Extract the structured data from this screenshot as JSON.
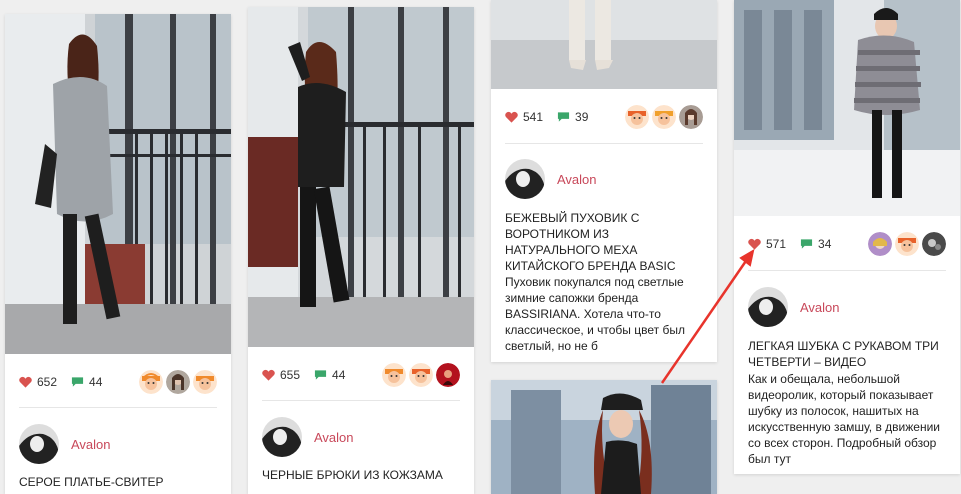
{
  "posts": [
    {
      "likes": "652",
      "comments": "44",
      "avatars": [
        "ginger-face-avatar",
        "woman-photo-avatar",
        "ginger-face-avatar"
      ],
      "author": "Avalon",
      "title": "СЕРОЕ ПЛАТЬЕ-СВИТЕР"
    },
    {
      "likes": "655",
      "comments": "44",
      "avatars": [
        "ginger-face-avatar",
        "ginger-face-avatar",
        "red-photo-avatar"
      ],
      "author": "Avalon",
      "title": "ЧЕРНЫЕ БРЮКИ ИЗ КОЖЗАМА"
    },
    {
      "likes": "541",
      "comments": "39",
      "avatars": [
        "ginger-face-avatar",
        "ginger-face-avatar",
        "woman-photo-avatar"
      ],
      "author": "Avalon",
      "title": "БЕЖЕВЫЙ ПУХОВИК С ВОРОТНИКОМ ИЗ НАТУРАЛЬНОГО МЕХА КИТАЙСКОГО БРЕНДА BASIC",
      "excerpt": "Пуховик покупался под светлые зимние сапожки бренда BASSIRIANA. Хотела что-то классическое, и чтобы цвет был светлый, но не б"
    },
    {
      "likes": "571",
      "comments": "34",
      "avatars": [
        "purple-photo-avatar",
        "ginger-face-avatar",
        "dark-photo-avatar"
      ],
      "author": "Avalon",
      "title": "ЛЕГКАЯ ШУБКА С РУКАВОМ ТРИ ЧЕТВЕРТИ – ВИДЕО",
      "excerpt": "Как и обещала, небольшой видеоролик, который показывает шубку из полосок, нашитых на искусственную замшу, в движении со всех сторон. Подробный обзор был тут"
    }
  ],
  "colors": {
    "heart": "#d9534f",
    "comment": "#3aa66a",
    "author": "#c8485a",
    "arrow": "#e8342c"
  }
}
